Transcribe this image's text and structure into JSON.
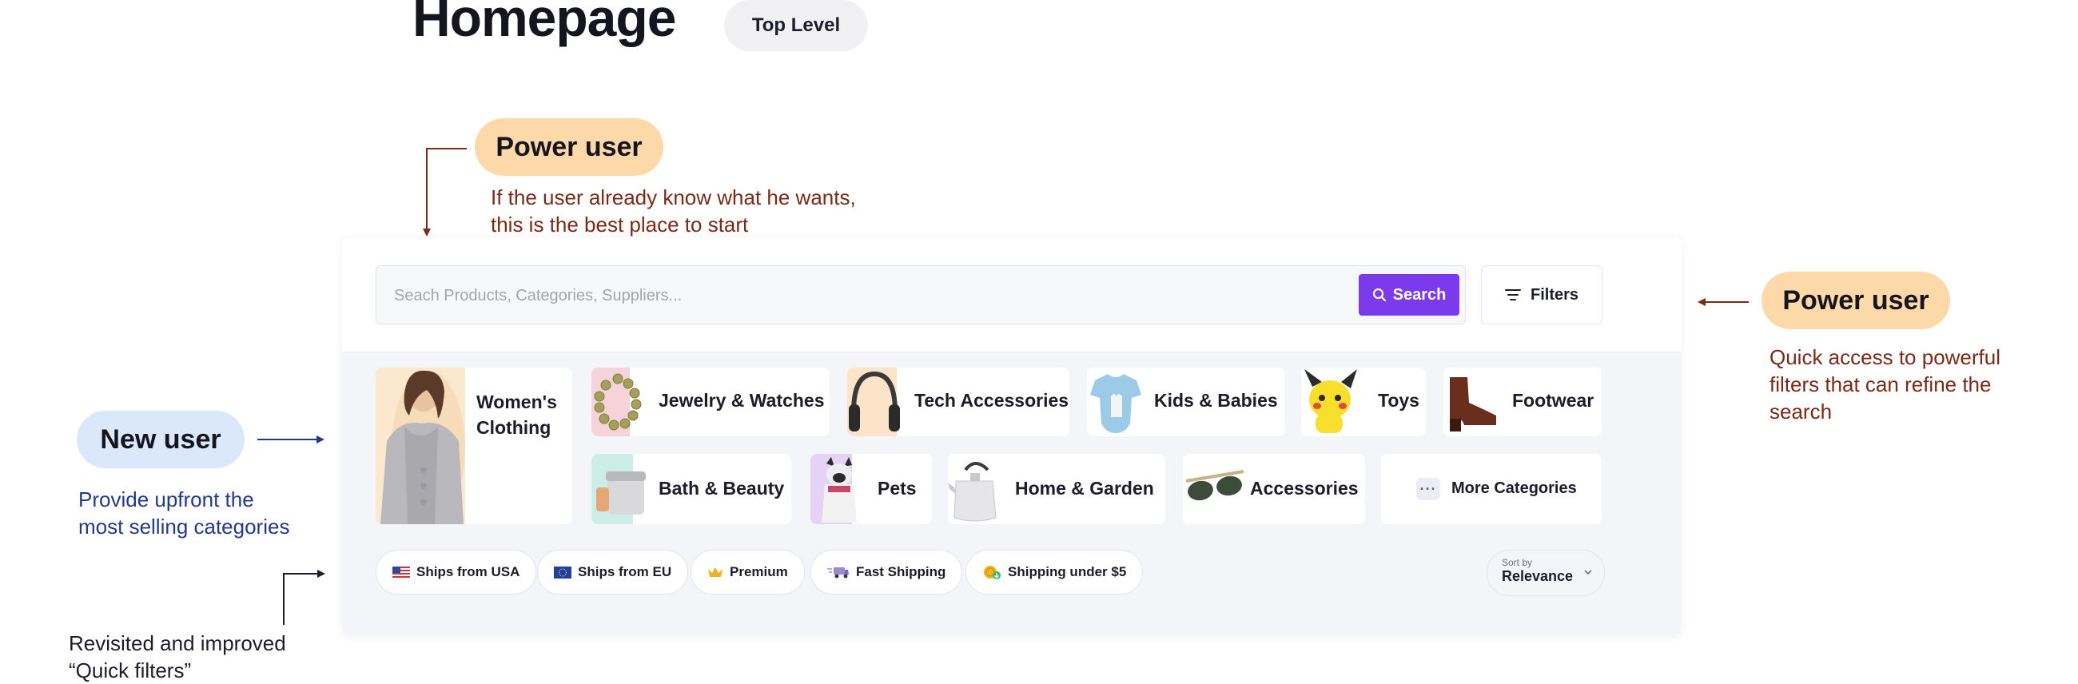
{
  "header": {
    "title": "Homepage",
    "level": "Top Level"
  },
  "annotations": {
    "power_user_search": {
      "pill": "Power user",
      "note_line1": "If the user already know what he wants,",
      "note_line2": "this is the best place to start"
    },
    "power_user_filters": {
      "pill": "Power user",
      "note_line1": "Quick access to powerful",
      "note_line2": "filters that can refine the",
      "note_line3": "search"
    },
    "new_user": {
      "pill": "New user",
      "note_line1": "Provide upfront the",
      "note_line2": "most selling categories"
    },
    "quick_filters": {
      "note_line1": "Revisited and improved",
      "note_line2": "“Quick filters”"
    }
  },
  "search": {
    "placeholder": "Seach Products, Categories, Suppliers...",
    "button_label": "Search",
    "filters_label": "Filters"
  },
  "categories": {
    "womens_line1": "Women's",
    "womens_line2": "Clothing",
    "jewelry": "Jewelry & Watches",
    "tech": "Tech Accessories",
    "kids": "Kids & Babies",
    "toys": "Toys",
    "footwear": "Footwear",
    "bath": "Bath & Beauty",
    "pets": "Pets",
    "home": "Home & Garden",
    "accessories": "Accessories",
    "more": "More Categories"
  },
  "quick_filters": {
    "usa": "Ships from USA",
    "eu": "Ships from EU",
    "premium": "Premium",
    "fast": "Fast Shipping",
    "under5": "Shipping under $5"
  },
  "sort": {
    "label": "Sort by",
    "value": "Relevance"
  },
  "colors": {
    "accent": "#7c3aed",
    "power_pill": "#fdd8a9",
    "new_pill": "#dbe7fb",
    "note_red": "#7a2a16",
    "note_blue": "#233a8c"
  }
}
